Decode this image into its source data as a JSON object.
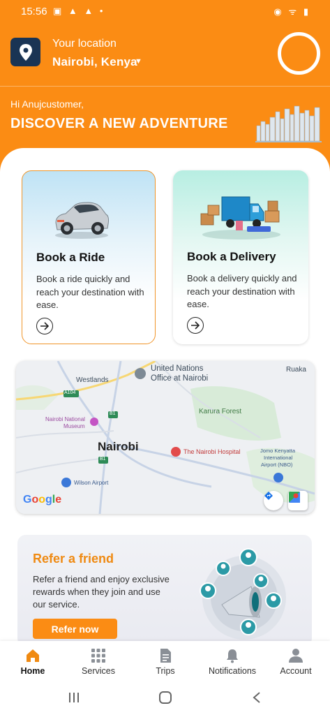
{
  "status_bar": {
    "time": "15:56",
    "left_icons": "▣ ▲ ▲ •",
    "right_icons": "◉ ᯤ ▮"
  },
  "location": {
    "label": "Your location",
    "value": "Nairobi, Kenya",
    "caret": "▼"
  },
  "greeting": "Hi Anujcustomer,",
  "headline": "DISCOVER A NEW ADVENTURE",
  "cards": {
    "ride": {
      "title": "Book a Ride",
      "description": "Book a ride quickly and reach your destination with ease."
    },
    "delivery": {
      "title": "Book a Delivery",
      "description": "Book a delivery quickly and reach your destination with ease."
    }
  },
  "map": {
    "city": "Nairobi",
    "labels": {
      "westlands": "Westlands",
      "un_office_1": "United Nations",
      "un_office_2": "Office at Nairobi",
      "ruaka": "Ruaka",
      "karura": "Karura Forest",
      "museum_1": "Nairobi National",
      "museum_2": "Museum",
      "hospital": "The Nairobi Hospital",
      "airport_1": "Jomo Kenyatta",
      "airport_2": "International",
      "airport_3": "Airport (NBO)",
      "wilson": "Wilson Airport",
      "road_a104": "A104",
      "road_b1a": "B1",
      "road_b1b": "B1"
    },
    "attribution": "Google"
  },
  "refer": {
    "title": "Refer a friend",
    "description": "Refer a friend and enjoy exclusive rewards when they join and use our service.",
    "button": "Refer now"
  },
  "bottom_nav": [
    {
      "label": "Home",
      "icon": "home-icon",
      "active": true
    },
    {
      "label": "Services",
      "icon": "grid-icon",
      "active": false
    },
    {
      "label": "Trips",
      "icon": "document-icon",
      "active": false
    },
    {
      "label": "Notifications",
      "icon": "bell-icon",
      "active": false
    },
    {
      "label": "Account",
      "icon": "person-icon",
      "active": false
    }
  ],
  "colors": {
    "brand_orange": "#fb8c14",
    "location_badge": "#1a3454"
  }
}
